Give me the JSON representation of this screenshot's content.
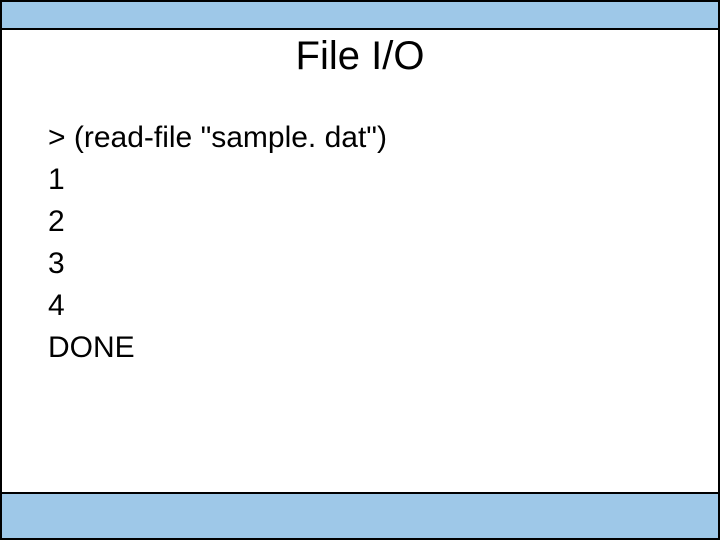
{
  "slide": {
    "title": "File I/O",
    "body": {
      "prompt_line": "> (read-file \"sample. dat\")",
      "output_lines": [
        "1",
        "2",
        "3",
        "4",
        "DONE"
      ]
    }
  }
}
